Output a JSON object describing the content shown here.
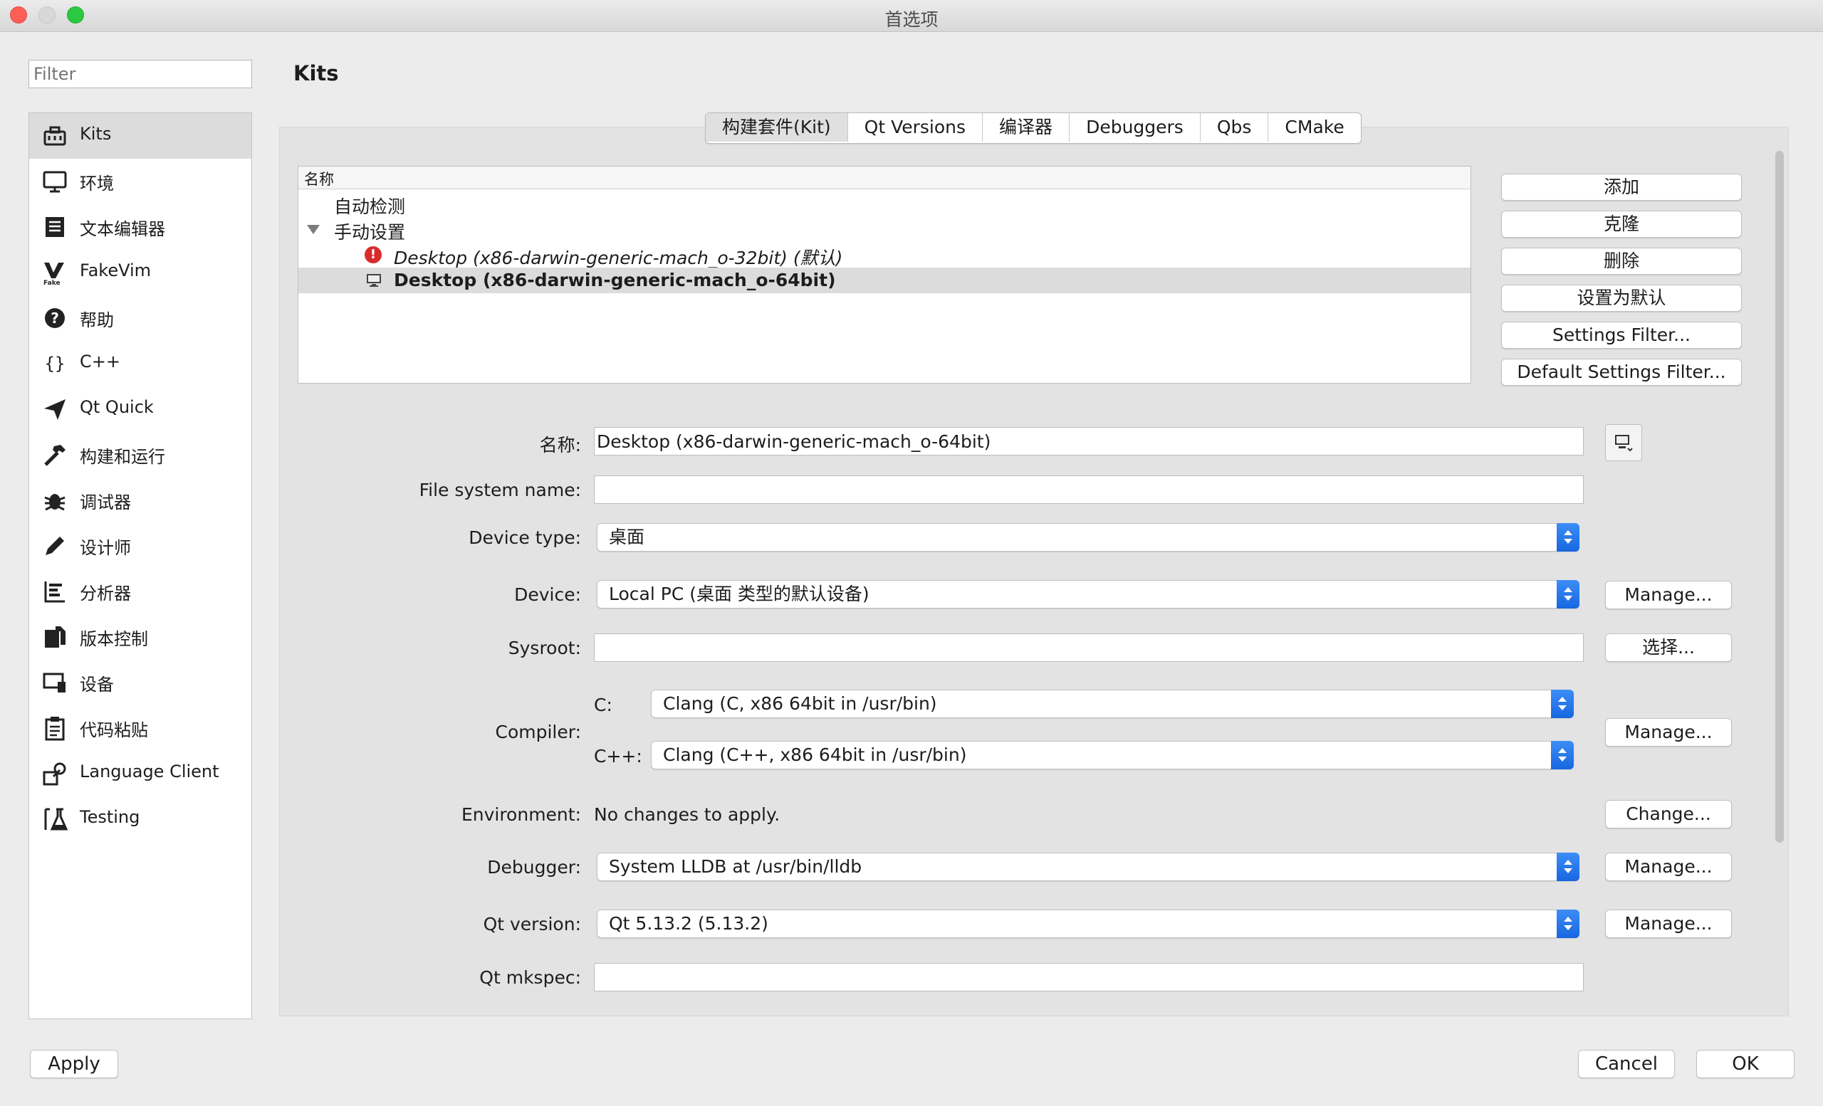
{
  "window": {
    "title": "首选项"
  },
  "filter": {
    "placeholder": "Filter"
  },
  "sidebar": {
    "items": [
      {
        "label": "Kits",
        "icon": "kits-icon",
        "selected": true
      },
      {
        "label": "环境",
        "icon": "monitor-icon"
      },
      {
        "label": "文本编辑器",
        "icon": "text-editor-icon"
      },
      {
        "label": "FakeVim",
        "icon": "fakevim-icon"
      },
      {
        "label": "帮助",
        "icon": "help-icon"
      },
      {
        "label": "C++",
        "icon": "braces-icon"
      },
      {
        "label": "Qt Quick",
        "icon": "paper-plane-icon"
      },
      {
        "label": "构建和运行",
        "icon": "hammer-icon"
      },
      {
        "label": "调试器",
        "icon": "bug-icon"
      },
      {
        "label": "设计师",
        "icon": "pencil-icon"
      },
      {
        "label": "分析器",
        "icon": "analyzer-icon"
      },
      {
        "label": "版本控制",
        "icon": "version-control-icon"
      },
      {
        "label": "设备",
        "icon": "device-icon"
      },
      {
        "label": "代码粘贴",
        "icon": "clipboard-icon"
      },
      {
        "label": "Language Client",
        "icon": "language-client-icon"
      },
      {
        "label": "Testing",
        "icon": "testing-icon"
      }
    ]
  },
  "page": {
    "title": "Kits"
  },
  "tabs": [
    {
      "label": "构建套件(Kit)",
      "active": true
    },
    {
      "label": "Qt Versions"
    },
    {
      "label": "编译器"
    },
    {
      "label": "Debuggers"
    },
    {
      "label": "Qbs"
    },
    {
      "label": "CMake"
    }
  ],
  "tree": {
    "header": "名称",
    "auto": "自动检测",
    "manual": "手动设置",
    "kit1": "Desktop (x86-darwin-generic-mach_o-32bit) (默认)",
    "kit2": "Desktop (x86-darwin-generic-mach_o-64bit)"
  },
  "side_buttons": {
    "add": "添加",
    "clone": "克隆",
    "remove": "删除",
    "make_default": "设置为默认",
    "settings_filter": "Settings Filter...",
    "default_settings_filter": "Default Settings Filter..."
  },
  "form": {
    "name_label": "名称:",
    "name_value": "Desktop (x86-darwin-generic-mach_o-64bit)",
    "fsname_label": "File system name:",
    "fsname_value": "",
    "devtype_label": "Device type:",
    "devtype_value": "桌面",
    "device_label": "Device:",
    "device_value": "Local PC (桌面 类型的默认设备)",
    "device_btn": "Manage...",
    "sysroot_label": "Sysroot:",
    "sysroot_value": "",
    "sysroot_btn": "选择...",
    "compiler_label": "Compiler:",
    "c_label": "C:",
    "c_value": "Clang (C, x86 64bit in /usr/bin)",
    "cpp_label": "C++:",
    "cpp_value": "Clang (C++, x86 64bit in /usr/bin)",
    "compiler_btn": "Manage...",
    "env_label": "Environment:",
    "env_value": "No changes to apply.",
    "env_btn": "Change...",
    "debugger_label": "Debugger:",
    "debugger_value": "System LLDB at /usr/bin/lldb",
    "debugger_btn": "Manage...",
    "qtver_label": "Qt version:",
    "qtver_value": "Qt 5.13.2 (5.13.2)",
    "qtver_btn": "Manage...",
    "mkspec_label": "Qt mkspec:",
    "mkspec_value": ""
  },
  "footer": {
    "apply": "Apply",
    "cancel": "Cancel",
    "ok": "OK"
  },
  "colors": {
    "accent": "#1767e0",
    "error": "#d92b2b",
    "selection": "#dcdcdc"
  }
}
